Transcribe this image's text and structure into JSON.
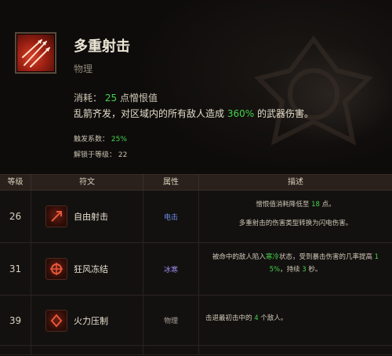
{
  "skill": {
    "name": "多重射击",
    "category": "物理",
    "cost_label": "消耗：",
    "cost_value": "25",
    "cost_unit": "点憎恨值",
    "desc_prefix": "乱箭齐发，对区域内的所有敌人造成",
    "desc_percent": "360%",
    "desc_suffix": "的武器伤害。",
    "coefficient_label": "触发系数：",
    "coefficient_value": "25%",
    "unlock_label": "解锁于等级：",
    "unlock_value": "22",
    "icon": "multishot-arrows-icon"
  },
  "table": {
    "headers": {
      "level": "等级",
      "rune": "符文",
      "attribute": "属性",
      "description": "描述"
    },
    "rows": [
      {
        "level": "26",
        "rune": "自由射击",
        "attribute": "电击",
        "attribute_color": "#6c8df0",
        "desc1_a": "憎恨值消耗降低至",
        "desc1_num": "18",
        "desc1_b": "点。",
        "desc2": "多重射击的伤害类型转换为闪电伤害。"
      },
      {
        "level": "31",
        "rune": "狂风冻结",
        "attribute": "冰寒",
        "attribute_color": "#9a8ff0",
        "desc1_a": "被命中的敌人陷入",
        "desc1_key": "寒冷",
        "desc1_b": "状态，受到暴击伤害的几率提高",
        "desc1_num": "1",
        "desc2_num": "5%",
        "desc2_a": "，持续",
        "desc2_num2": "3",
        "desc2_b": "秒。"
      },
      {
        "level": "39",
        "rune": "火力压制",
        "attribute": "物理",
        "attribute_color": "#a8a294",
        "desc1_a": "击退最初击中的",
        "desc1_num": "4",
        "desc1_b": "个敌人。"
      }
    ]
  }
}
